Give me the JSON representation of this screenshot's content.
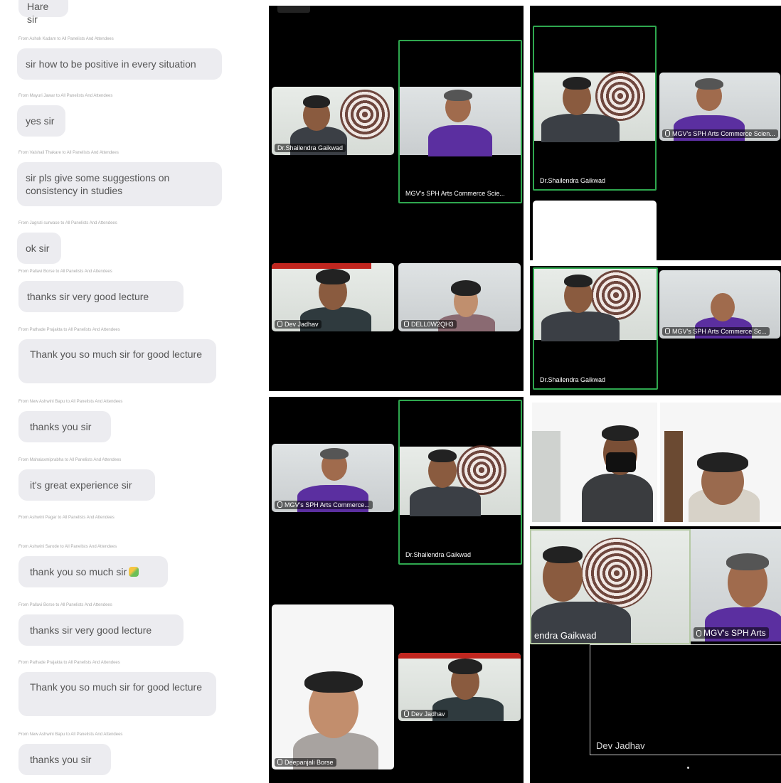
{
  "chat": {
    "messages": [
      {
        "meta": "From Ashok Kadam to All Panelists And Attendees",
        "text": "sir how to be positive in every situation"
      },
      {
        "meta": "From Mayuri Jawar to All Panelists And Attendees",
        "text": "yes sir"
      },
      {
        "meta": "From Vaishali Thakare to All Panelists And Attendees",
        "text": "sir pls give some suggestions on consistency in studies"
      },
      {
        "meta": "From Jagruti surwase to All Panelists And Attendees",
        "text": "ok sir"
      },
      {
        "meta": "From Pallavi Borse to All Panelists And Attendees",
        "text": "thanks sir very good lecture"
      },
      {
        "meta": "From Pathade Prajakta to All Panelists And Attendees",
        "text": "Thank you so much sir for good lecture"
      },
      {
        "meta": "From New Ashwini Bapu to All Panelists And Attendees",
        "text": "thanks you sir"
      },
      {
        "meta": "From Mahalaxmiprabha to All Panelists And Attendees",
        "text": "it's great experience sir"
      },
      {
        "meta": "From Ashwini Pagar to All Panelists And Attendees",
        "text": ""
      },
      {
        "meta": "From Ashwini Sarode to All Panelists And Attendees",
        "text": "thank you so much sir"
      },
      {
        "meta": "From Pallavi Borse to All Panelists And Attendees",
        "text": "thanks sir very good lecture"
      },
      {
        "meta": "From Pathade Prajakta to All Panelists And Attendees",
        "text": "Thank you so much sir for good lecture"
      },
      {
        "meta": "From New Ashwini Bapu to All Panelists And Attendees",
        "text": "thanks you sir"
      }
    ],
    "top_partial": "Hare sir"
  },
  "participants": {
    "shailendra_a": "Dr.Shailendra Gaikwad",
    "shailendra_b": "Dr.Shailendra Gaikwad",
    "shailendra_c": "Dr.Shailendra Gaikwad",
    "shailendra_d": "Dr.Shailendra Gaikwad",
    "shailendra_e": "Dr.Shailendra Gaikwad",
    "shailendra_partial": "endra Gaikwad",
    "mgv_a": "MGV's SPH Arts Commerce Scie...",
    "mgv_b": "MGV's SPH Arts Commerce Scien...",
    "mgv_c": "MGV's SPH Arts Commerce Sc...",
    "mgv_d": "MGV's SPH Arts Commerce...",
    "mgv_e": "MGV's SPH Arts",
    "dev_a": "Dev Jadhav",
    "dev_b": "Dev Jadhav",
    "dev_c": "Dev Jadhav",
    "dell": "DELL0W2QH3",
    "deepanjali": "Deepanjali Borse"
  }
}
